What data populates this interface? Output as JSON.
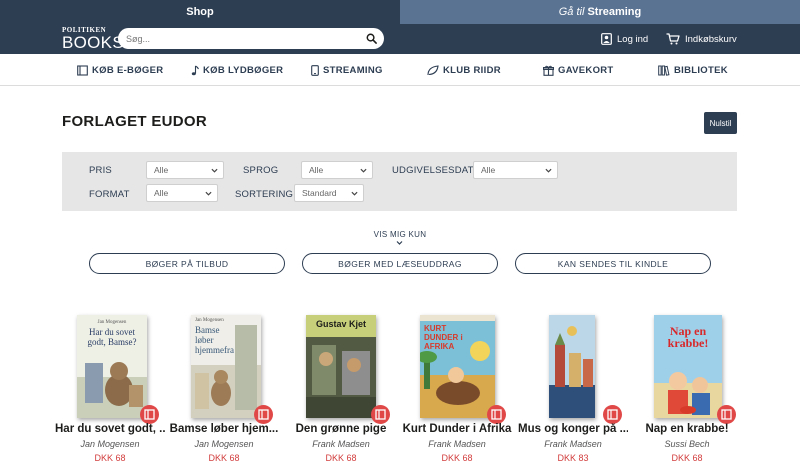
{
  "topstrip": {
    "shop": "Shop",
    "stream_prefix": "Gå til",
    "stream_label": "Streaming"
  },
  "header": {
    "logo_top": "POLITIKEN",
    "logo_bottom": "BOOKS",
    "search_placeholder": "Søg...",
    "login": "Log ind",
    "cart": "Indkøbskurv"
  },
  "nav": [
    {
      "label": "KØB E-BØGER",
      "icon": "book-icon"
    },
    {
      "label": "KØB LYDBØGER",
      "icon": "music-note-icon"
    },
    {
      "label": "STREAMING",
      "icon": "tablet-icon"
    },
    {
      "label": "KLUB RIIDR",
      "icon": "leaf-icon"
    },
    {
      "label": "GAVEKORT",
      "icon": "gift-icon"
    },
    {
      "label": "BIBLIOTEK",
      "icon": "library-icon"
    }
  ],
  "page": {
    "title": "FORLAGET EUDOR",
    "reset": "Nulstil"
  },
  "filters": {
    "pris_label": "PRIS",
    "pris_value": "Alle",
    "sprog_label": "SPROG",
    "sprog_value": "Alle",
    "dato_label": "UDGIVELSESDATO",
    "dato_value": "Alle",
    "format_label": "FORMAT",
    "format_value": "Alle",
    "sort_label": "SORTERING",
    "sort_value": "Standard"
  },
  "quick": {
    "label": "VIS MIG KUN",
    "btn1": "BØGER PÅ TILBUD",
    "btn2": "BØGER MED LÆSEUDDRAG",
    "btn3": "KAN SENDES TIL KINDLE"
  },
  "products": [
    {
      "title": "Har du sovet godt, ...",
      "author": "Jan Mogensen",
      "price": "DKK 68",
      "cover_author": "Jan Mogensen",
      "cover_title": "Har du sovet godt, Bamse?"
    },
    {
      "title": "Bamse løber hjem...",
      "author": "Jan Mogensen",
      "price": "DKK 68",
      "cover_author": "Jan Mogensen",
      "cover_title": "Bamse løber hjemmefra"
    },
    {
      "title": "Den grønne pige",
      "author": "Frank Madsen",
      "price": "DKK 68",
      "cover_title": "Gustav Kjet"
    },
    {
      "title": "Kurt Dunder i Afrika",
      "author": "Frank Madsen",
      "price": "DKK 68",
      "cover_title": "KURT DUNDER i AFRIKA"
    },
    {
      "title": "Mus og konger på ...",
      "author": "Frank Madsen",
      "price": "DKK 83"
    },
    {
      "title": "Nap en krabbe!",
      "author": "Sussi Bech",
      "price": "DKK 68",
      "cover_title": "Nap en krabbe!"
    }
  ],
  "colors": {
    "navy": "#2d3d52",
    "stream_tab": "#5a7393",
    "price": "#d23c3c",
    "ebook_badge": "#e04848"
  }
}
